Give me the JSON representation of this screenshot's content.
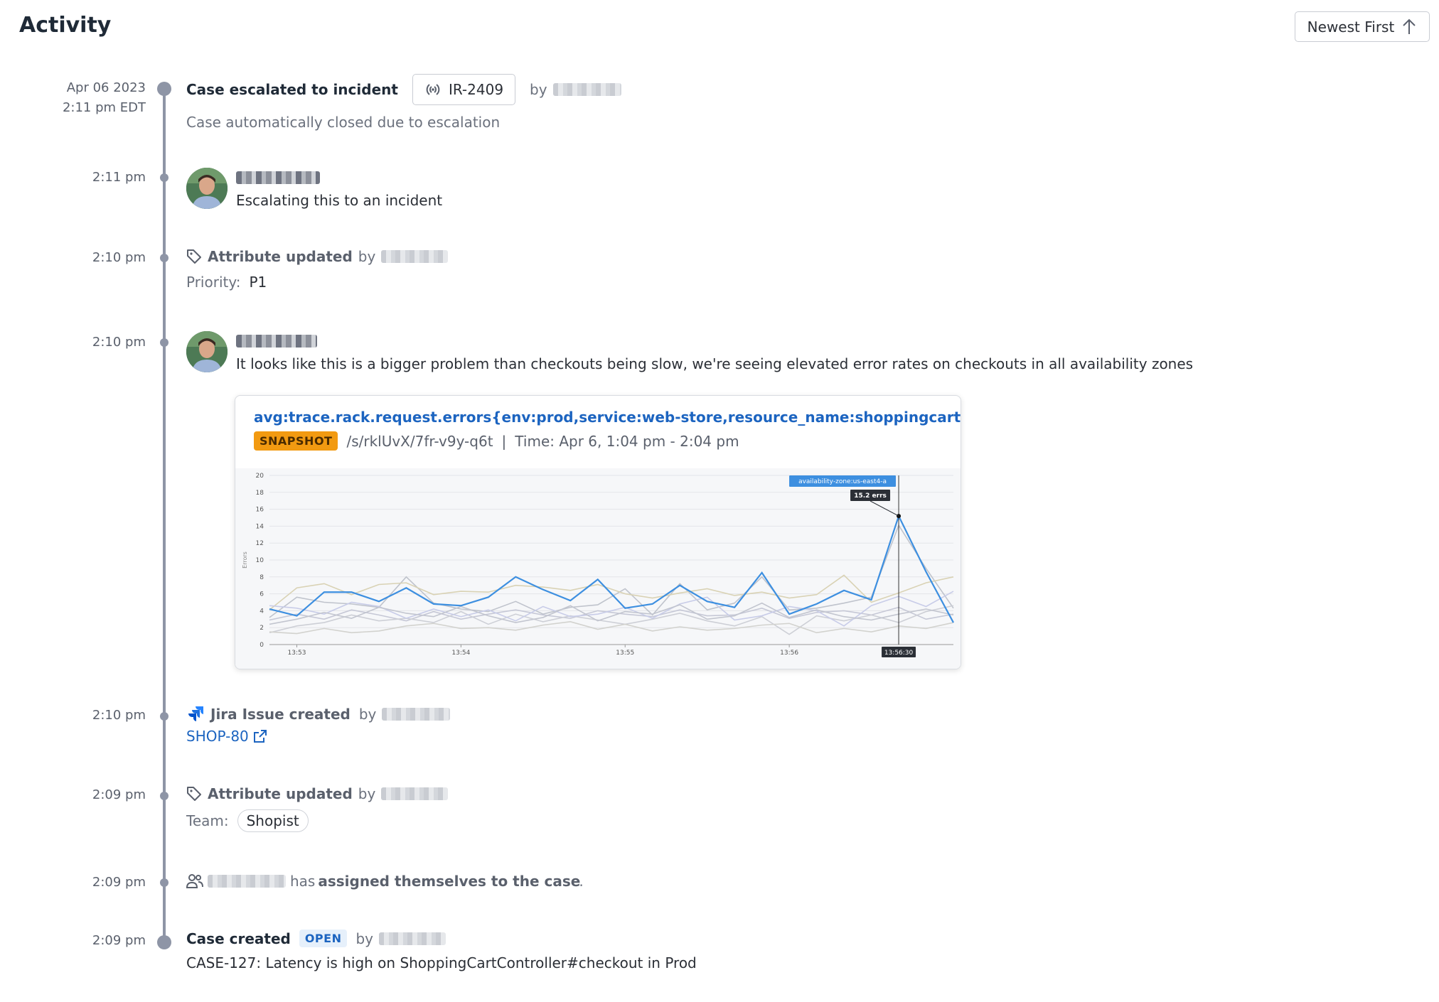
{
  "header": {
    "title": "Activity",
    "sort_label": "Newest First"
  },
  "events": [
    {
      "date": "Apr 06 2023",
      "time": "2:11 pm EDT",
      "title": "Case escalated to incident",
      "incident_id": "IR-2409",
      "by": "by",
      "description": "Case automatically closed due to escalation"
    },
    {
      "time": "2:11 pm",
      "comment": "Escalating this to an incident"
    },
    {
      "time": "2:10 pm",
      "title": "Attribute updated",
      "by": "by",
      "field_label": "Priority:",
      "field_value": "P1"
    },
    {
      "time": "2:10 pm",
      "comment": "It looks like this is a bigger problem than checkouts being slow, we're seeing elevated error rates on checkouts in all availability zones"
    },
    {
      "time": "2:10 pm",
      "title": "Jira Issue created",
      "by": "by",
      "issue_key": "SHOP-80"
    },
    {
      "time": "2:09 pm",
      "title": "Attribute updated",
      "by": "by",
      "field_label": "Team:",
      "field_value": "Shopist"
    },
    {
      "time": "2:09 pm",
      "text_pre": "has",
      "text_bold": "assigned themselves to the case",
      "text_post": "."
    },
    {
      "time": "2:09 pm",
      "title": "Case created",
      "status": "OPEN",
      "by": "by",
      "description": "CASE-127: Latency is high on ShoppingCartController#checkout in Prod"
    }
  ],
  "snapshot": {
    "query": "avg:trace.rack.request.errors{env:prod,service:web-store,resource_name:shoppingcartcontrol...",
    "badge": "SNAPSHOT",
    "path": "/s/rklUvX/7fr-v9y-q6t",
    "separator": "|",
    "time_range": "Time: Apr 6, 1:04 pm - 2:04 pm"
  },
  "chart_data": {
    "type": "line",
    "ylabel": "Errors",
    "ylim": [
      0,
      20
    ],
    "y_ticks": [
      "0",
      "2",
      "4",
      "6",
      "8",
      "10",
      "12",
      "14",
      "16",
      "18",
      "20"
    ],
    "x_tick_labels": [
      "13:53",
      "13:54",
      "13:55",
      "13:56"
    ],
    "x_tick_positions": [
      1,
      7,
      13,
      19
    ],
    "tooltip_series": "availability-zone:us-east4-a",
    "tooltip_value": "15.2 errs",
    "cursor_label": "13:56:30",
    "cursor_index": 23,
    "highlight_color": "#3d8fe0",
    "series": [
      {
        "values": [
          4.2,
          3.4,
          6.2,
          6.2,
          5.1,
          6.7,
          4.8,
          4.6,
          5.6,
          8.0,
          6.5,
          5.2,
          7.7,
          4.3,
          4.8,
          7.0,
          5.1,
          4.4,
          8.5,
          3.6,
          4.8,
          6.4,
          5.3,
          15.2,
          8.6,
          2.6
        ]
      },
      {
        "values": [
          3.2,
          5.6,
          5.0,
          4.8,
          4.4,
          8.0,
          4.9,
          4.2,
          3.9,
          5.1,
          3.6,
          4.4,
          4.7,
          6.6,
          3.5,
          7.2,
          4.1,
          4.9,
          8.0,
          4.1,
          4.3,
          4.9,
          5.6,
          14.1,
          9.0,
          4.3
        ]
      },
      {
        "values": [
          4.1,
          6.7,
          7.2,
          5.9,
          7.1,
          7.3,
          5.9,
          6.3,
          6.2,
          7.0,
          6.8,
          6.4,
          7.1,
          6.0,
          5.5,
          6.1,
          6.6,
          5.8,
          6.2,
          5.5,
          5.9,
          8.2,
          5.0,
          6.1,
          7.3,
          8.0
        ]
      },
      {
        "values": [
          2.9,
          3.6,
          3.0,
          4.1,
          3.5,
          2.8,
          3.9,
          3.0,
          3.6,
          4.1,
          3.5,
          3.1,
          4.0,
          3.6,
          3.3,
          4.1,
          3.4,
          3.5,
          4.3,
          3.1,
          3.8,
          4.0,
          3.5,
          4.4,
          3.0,
          3.6
        ]
      },
      {
        "values": [
          1.4,
          2.2,
          2.6,
          3.5,
          2.8,
          3.1,
          2.6,
          3.9,
          2.4,
          3.6,
          2.7,
          3.4,
          2.9,
          2.4,
          3.0,
          3.7,
          2.8,
          2.2,
          3.3,
          1.2,
          3.4,
          2.8,
          3.5,
          2.6,
          3.9,
          4.6
        ]
      },
      {
        "values": [
          4.6,
          4.3,
          3.6,
          5.0,
          4.5,
          3.1,
          4.2,
          3.3,
          4.1,
          2.8,
          4.5,
          3.3,
          3.6,
          4.4,
          3.1,
          4.8,
          5.6,
          2.9,
          3.4,
          4.5,
          4.0,
          2.2,
          4.6,
          5.7,
          4.5,
          6.3
        ]
      },
      {
        "values": [
          1.5,
          1.3,
          1.9,
          1.4,
          1.6,
          2.2,
          2.5,
          1.9,
          2.0,
          1.7,
          2.3,
          2.7,
          1.8,
          2.4,
          1.6,
          2.1,
          1.7,
          1.9,
          2.3,
          2.5,
          1.4,
          1.9,
          1.5,
          2.2,
          1.9,
          2.6
        ]
      },
      {
        "values": [
          2.4,
          3.0,
          3.8,
          3.1,
          4.4,
          3.7,
          3.3,
          4.5,
          3.4,
          2.6,
          3.2,
          4.6,
          2.8,
          3.9,
          3.6,
          4.7,
          3.0,
          3.4,
          4.9,
          3.2,
          4.1,
          3.3,
          2.9,
          3.6,
          4.2,
          3.5
        ]
      }
    ]
  }
}
